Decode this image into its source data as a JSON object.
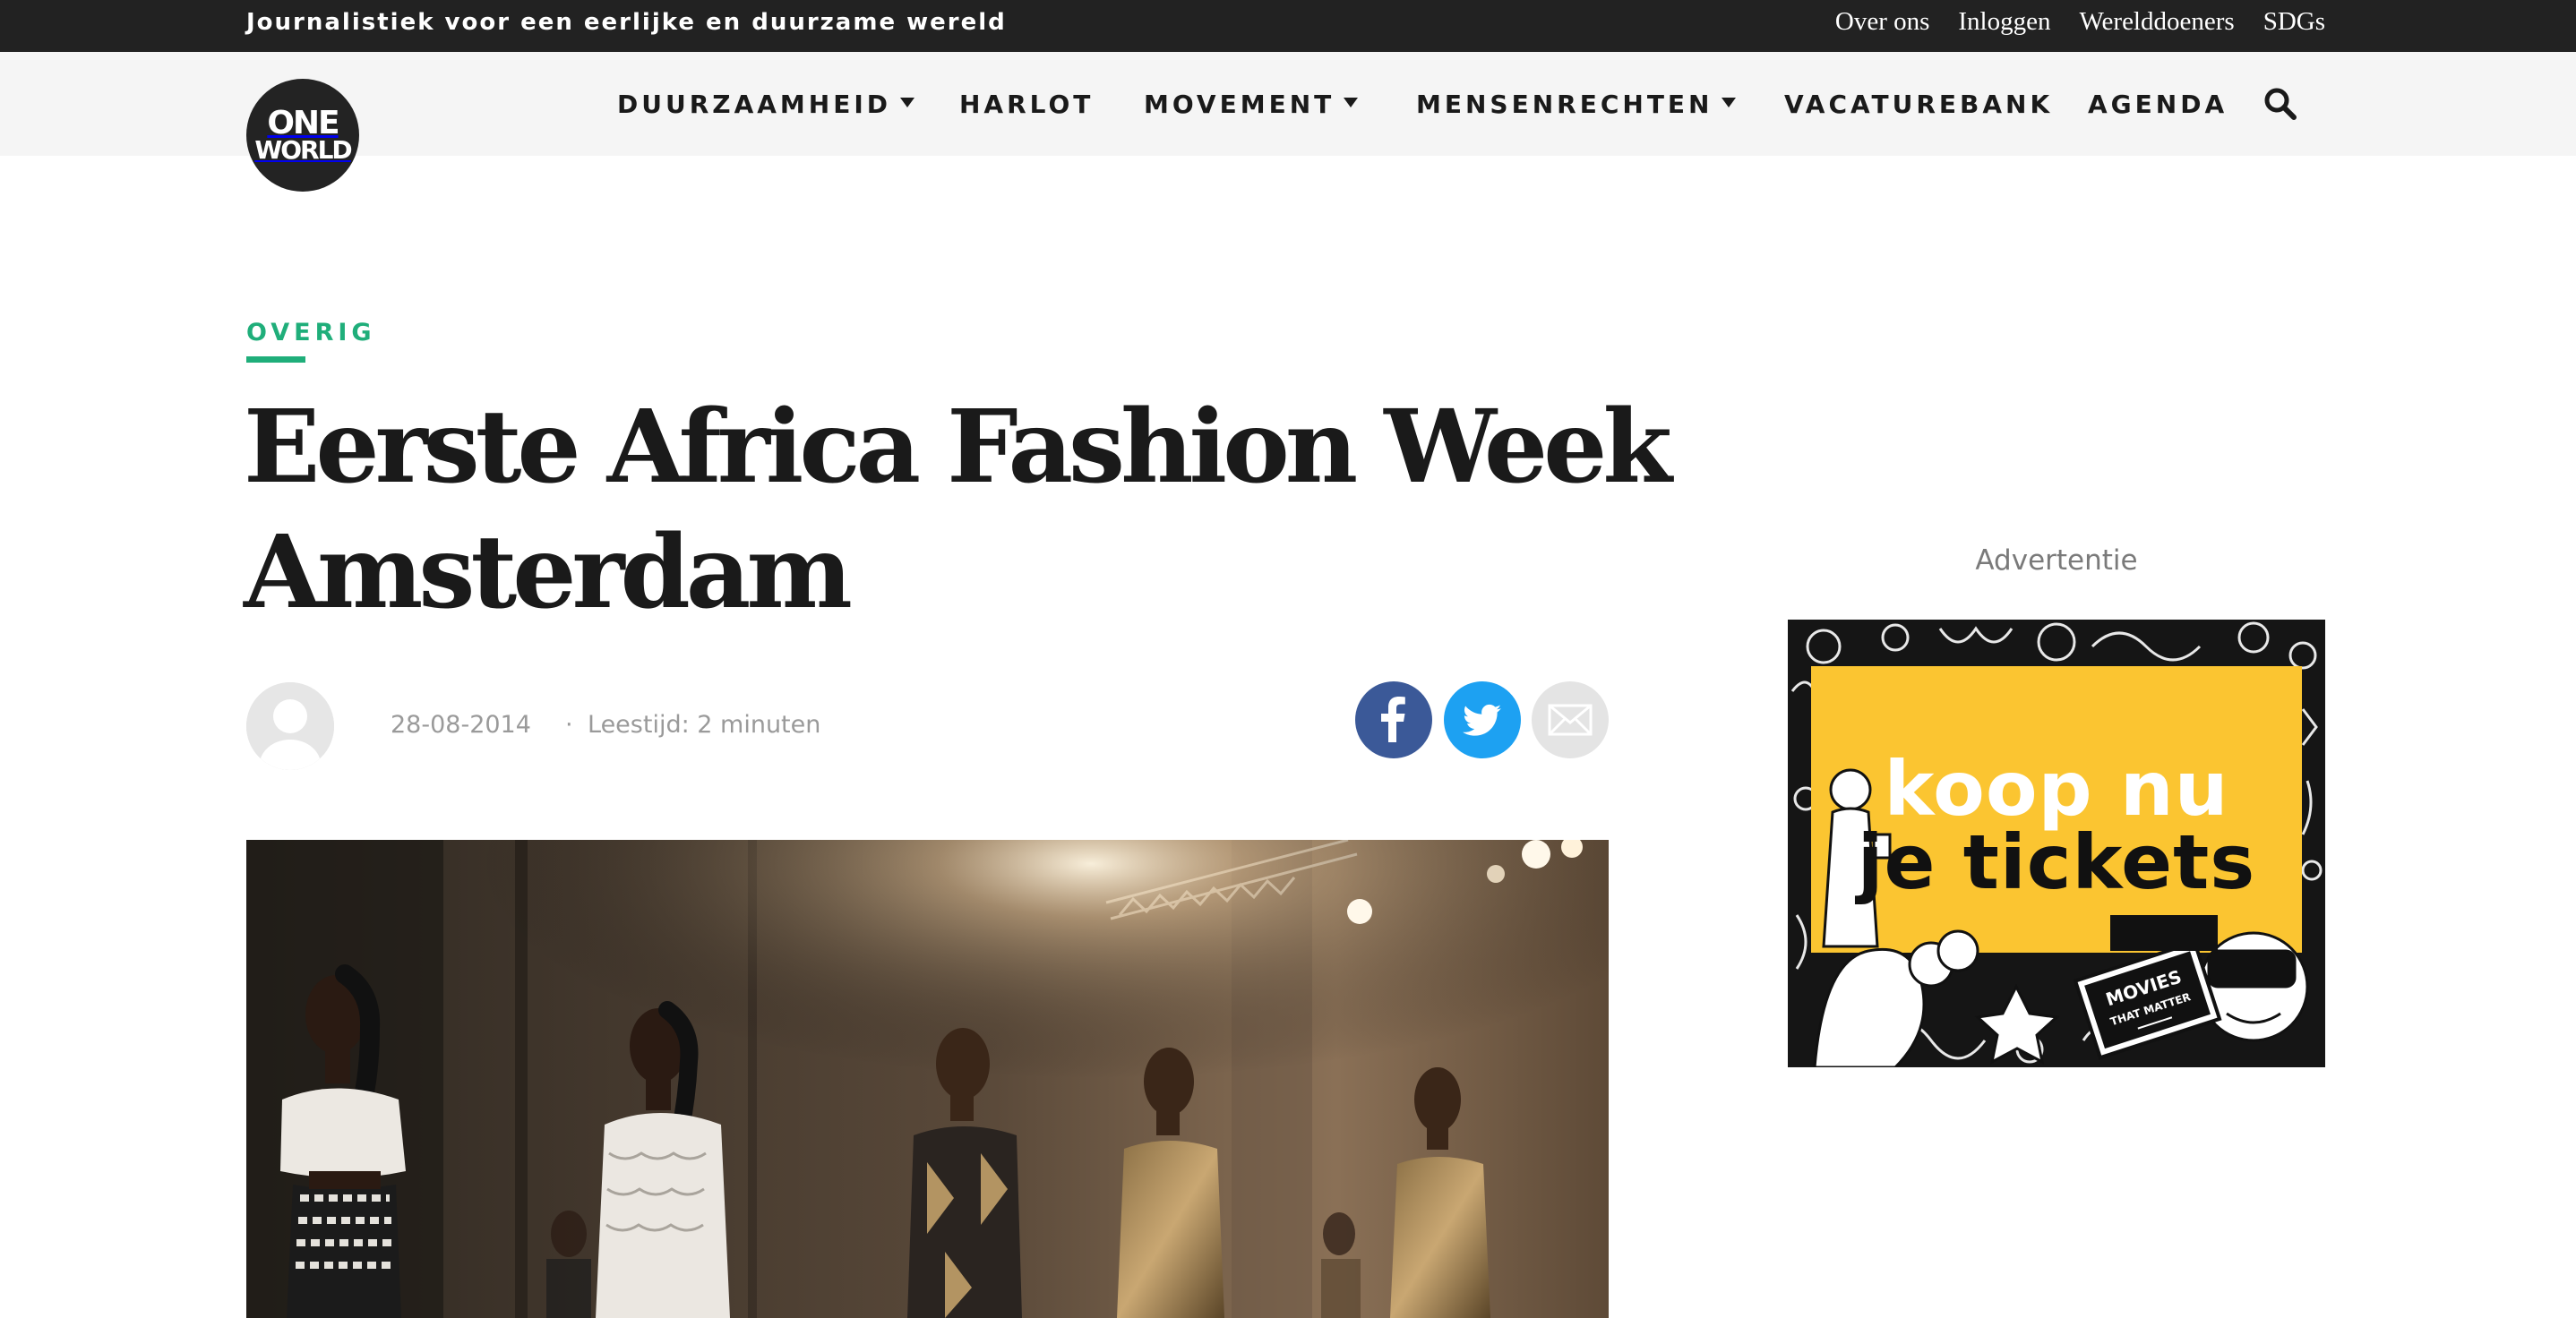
{
  "topbar": {
    "tagline": "Journalistiek voor een eerlijke en duurzame wereld",
    "links": [
      "Over ons",
      "Inloggen",
      "Werelddoeners",
      "SDGs"
    ]
  },
  "logo": {
    "line1": "ONE",
    "line2": "WORLD"
  },
  "nav": {
    "items": [
      {
        "label": "DUURZAAMHEID",
        "dropdown": true
      },
      {
        "label": "HARLOT",
        "dropdown": false
      },
      {
        "label": "MOVEMENT",
        "dropdown": true
      },
      {
        "label": "MENSENRECHTEN",
        "dropdown": true
      },
      {
        "label": "VACATUREBANK",
        "dropdown": false
      },
      {
        "label": "AGENDA",
        "dropdown": false
      }
    ],
    "search_icon": "search-icon"
  },
  "article": {
    "category": "OVERIG",
    "title": "Eerste Africa Fashion Week Amsterdam",
    "date": "28-08-2014",
    "separator": "·",
    "reading_time": "Leestijd: 2 minuten",
    "share": [
      "facebook-icon",
      "twitter-icon",
      "email-icon"
    ]
  },
  "sidebar": {
    "ad_label": "Advertentie",
    "ad_line1": "koop nu",
    "ad_line2": "je tickets",
    "ad_badge_line1": "MOVIES",
    "ad_badge_line2": "THAT MATTER"
  },
  "colors": {
    "topbar_bg": "#222222",
    "navbar_bg": "#f5f5f5",
    "accent_green": "#1fae7a",
    "facebook": "#3b5998",
    "twitter": "#1da1f2",
    "ad_yellow": "#fbc531"
  }
}
